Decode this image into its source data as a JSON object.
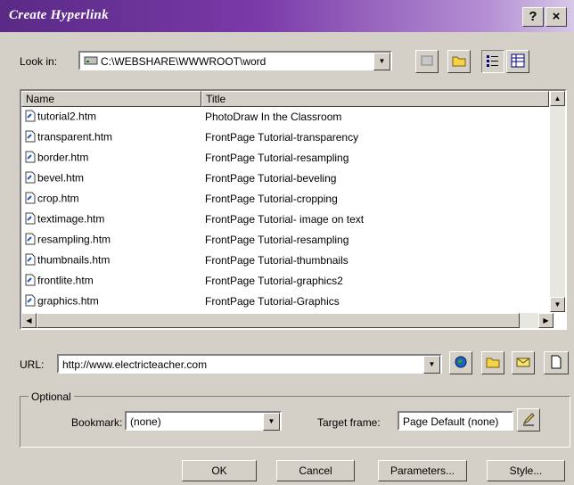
{
  "window": {
    "title": "Create Hyperlink",
    "help_label": "?",
    "close_label": "×"
  },
  "lookin": {
    "label": "Look in:",
    "path": "C:\\WEBSHARE\\WWWROOT\\word"
  },
  "list": {
    "columns": [
      "Name",
      "Title"
    ],
    "rows": [
      {
        "name": "tutorial2.htm",
        "title": "PhotoDraw In the Classroom"
      },
      {
        "name": "transparent.htm",
        "title": "FrontPage Tutorial-transparency"
      },
      {
        "name": "border.htm",
        "title": "FrontPage Tutorial-resampling"
      },
      {
        "name": "bevel.htm",
        "title": "FrontPage Tutorial-beveling"
      },
      {
        "name": "crop.htm",
        "title": "FrontPage Tutorial-cropping"
      },
      {
        "name": "textimage.htm",
        "title": "FrontPage Tutorial- image on text"
      },
      {
        "name": "resampling.htm",
        "title": "FrontPage Tutorial-resampling"
      },
      {
        "name": "thumbnails.htm",
        "title": "FrontPage Tutorial-thumbnails"
      },
      {
        "name": "frontlite.htm",
        "title": "FrontPage Tutorial-graphics2"
      },
      {
        "name": "graphics.htm",
        "title": "FrontPage Tutorial-Graphics"
      }
    ]
  },
  "url": {
    "label": "URL:",
    "value": "http://www.electricteacher.com"
  },
  "optional": {
    "group_label": "Optional",
    "bookmark_label": "Bookmark:",
    "bookmark_value": "(none)",
    "target_label": "Target frame:",
    "target_value": "Page Default (none)"
  },
  "buttons": {
    "ok": "OK",
    "cancel": "Cancel",
    "parameters": "Parameters...",
    "style": "Style..."
  }
}
